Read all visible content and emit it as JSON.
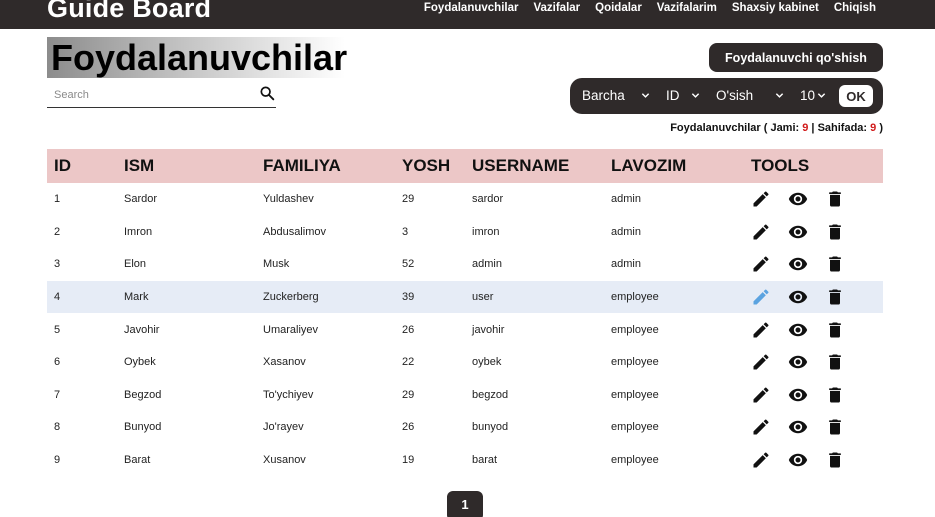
{
  "navbar": {
    "brand": "Guide Board",
    "links": [
      "Foydalanuvchilar",
      "Vazifalar",
      "Qoidalar",
      "Vazifalarim",
      "Shaxsiy kabinet",
      "Chiqish"
    ]
  },
  "page": {
    "title": "Foydalanuvchilar"
  },
  "search": {
    "placeholder": "Search",
    "value": ""
  },
  "actions": {
    "add_user_label": "Foydalanuvchi qo'shish"
  },
  "filters": {
    "role": "Barcha",
    "sort_field": "ID",
    "sort_order": "O'sish",
    "page_size": "10",
    "ok_label": "OK"
  },
  "summary": {
    "prefix": "Foydalanuvchilar ( Jami: ",
    "total": "9",
    "separator": " | Sahifada: ",
    "on_page": "9",
    "suffix": " )"
  },
  "table": {
    "headers": [
      "ID",
      "ISM",
      "FAMILIYA",
      "YOSH",
      "USERNAME",
      "LAVOZIM",
      "TOOLS"
    ],
    "rows": [
      {
        "id": "1",
        "ism": "Sardor",
        "familiya": "Yuldashev",
        "yosh": "29",
        "username": "sardor",
        "lavozim": "admin"
      },
      {
        "id": "2",
        "ism": "Imron",
        "familiya": "Abdusalimov",
        "yosh": "3",
        "username": "imron",
        "lavozim": "admin"
      },
      {
        "id": "3",
        "ism": "Elon",
        "familiya": "Musk",
        "yosh": "52",
        "username": "admin",
        "lavozim": "admin"
      },
      {
        "id": "4",
        "ism": "Mark",
        "familiya": "Zuckerberg",
        "yosh": "39",
        "username": "user",
        "lavozim": "employee"
      },
      {
        "id": "5",
        "ism": "Javohir",
        "familiya": "Umaraliyev",
        "yosh": "26",
        "username": "javohir",
        "lavozim": "employee"
      },
      {
        "id": "6",
        "ism": "Oybek",
        "familiya": "Xasanov",
        "yosh": "22",
        "username": "oybek",
        "lavozim": "employee"
      },
      {
        "id": "7",
        "ism": "Begzod",
        "familiya": "To'ychiyev",
        "yosh": "29",
        "username": "begzod",
        "lavozim": "employee"
      },
      {
        "id": "8",
        "ism": "Bunyod",
        "familiya": "Jo'rayev",
        "yosh": "26",
        "username": "bunyod",
        "lavozim": "employee"
      },
      {
        "id": "9",
        "ism": "Barat",
        "familiya": "Xusanov",
        "yosh": "19",
        "username": "barat",
        "lavozim": "employee"
      }
    ],
    "tool_icons": [
      "pencil-icon",
      "eye-icon",
      "trash-icon"
    ],
    "hovered_row": "4"
  },
  "pagination": {
    "current_page": "1"
  },
  "colors": {
    "navbar": "#2f2a2a",
    "header_row": "#ecc7c7",
    "highlight_row": "#e6ecf6",
    "count": "#d11a1a",
    "edit_hover": "#5ba3e0"
  }
}
